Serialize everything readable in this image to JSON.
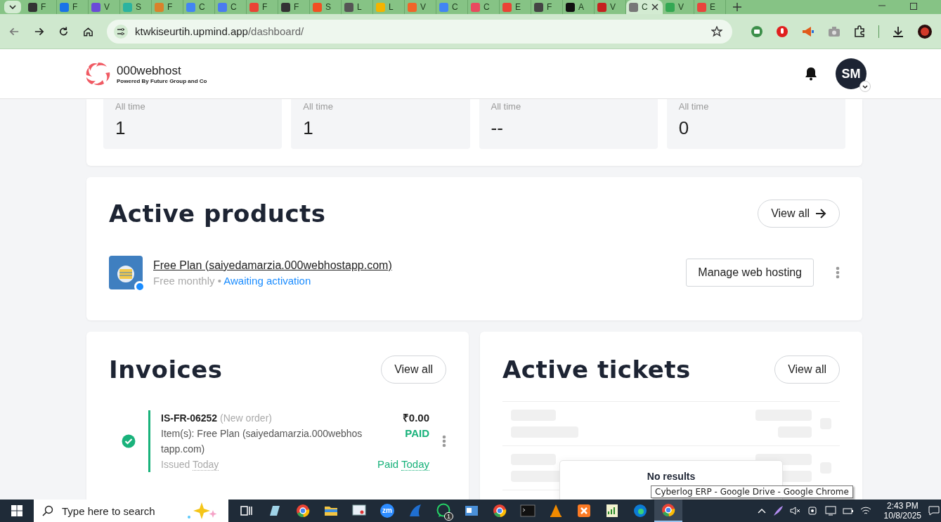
{
  "browser": {
    "tabs": [
      {
        "label": "F",
        "color": "#333333",
        "selected": false
      },
      {
        "label": "F",
        "color": "#1a73e8",
        "selected": false
      },
      {
        "label": "V",
        "color": "#6b4bd8",
        "selected": false
      },
      {
        "label": "S",
        "color": "#2bb3a0",
        "selected": false
      },
      {
        "label": "F",
        "color": "#d9822b",
        "selected": false
      },
      {
        "label": "C",
        "color": "#4285f4",
        "selected": false
      },
      {
        "label": "C",
        "color": "#4a7cf0",
        "selected": false
      },
      {
        "label": "F",
        "color": "#ea4335",
        "selected": false
      },
      {
        "label": "F",
        "color": "#333333",
        "selected": false
      },
      {
        "label": "S",
        "color": "#f25022",
        "selected": false
      },
      {
        "label": "L",
        "color": "#555555",
        "selected": false
      },
      {
        "label": "L",
        "color": "#f4b400",
        "selected": false
      },
      {
        "label": "V",
        "color": "#f06529",
        "selected": false
      },
      {
        "label": "C",
        "color": "#4285f4",
        "selected": false
      },
      {
        "label": "C",
        "color": "#e84a5f",
        "selected": false
      },
      {
        "label": "E",
        "color": "#ea4335",
        "selected": false
      },
      {
        "label": "F",
        "color": "#444444",
        "selected": false
      },
      {
        "label": "A",
        "color": "#111111",
        "selected": false
      },
      {
        "label": "V",
        "color": "#c5221f",
        "selected": false
      },
      {
        "label": "C",
        "color": "#777777",
        "selected": true
      },
      {
        "label": "V",
        "color": "#34a853",
        "selected": false
      },
      {
        "label": "E",
        "color": "#e8453c",
        "selected": false
      }
    ],
    "address": {
      "host": "ktwkiseurtih.upmind.app",
      "path": "/dashboard/"
    }
  },
  "header": {
    "brand": "000webhost",
    "tagline": "Powered By Future Group and Co",
    "avatar": "SM"
  },
  "stats": [
    {
      "label": "All time",
      "value": "1"
    },
    {
      "label": "All time",
      "value": "1"
    },
    {
      "label": "All time",
      "value": "--"
    },
    {
      "label": "All time",
      "value": "0"
    }
  ],
  "products": {
    "title": "Active products",
    "view_all": "View all",
    "items": [
      {
        "name": "Free Plan (saiyedamarzia.000webhostapp.com)",
        "billing": "Free monthly",
        "separator": "•",
        "status": "Awaiting activation",
        "action": "Manage web hosting"
      }
    ]
  },
  "invoices": {
    "title": "Invoices",
    "view_all": "View all",
    "items": [
      {
        "number": "IS-FR-06252",
        "tag": "(New order)",
        "description": "Item(s): Free Plan (saiyedamarzia.000webhostapp.com)",
        "amount": "₹0.00",
        "status": "PAID",
        "issued_label": "Issued",
        "issued": "Today",
        "paid_label": "Paid",
        "paid": "Today"
      }
    ]
  },
  "tickets": {
    "title": "Active tickets",
    "view_all": "View all",
    "empty_text": "No results"
  },
  "tooltip": "Cyberlog ERP - Google Drive - Google Chrome",
  "taskbar": {
    "search_placeholder": "Type here to search",
    "apps": [
      {
        "kind": "taskview",
        "active": false
      },
      {
        "kind": "notes",
        "active": false
      },
      {
        "kind": "chrome",
        "active": false
      },
      {
        "kind": "folder",
        "active": false
      },
      {
        "kind": "monitor",
        "active": false
      },
      {
        "kind": "zoom",
        "label": "zm",
        "active": false
      },
      {
        "kind": "fin",
        "active": false
      },
      {
        "kind": "chat",
        "badge": "1",
        "active": false
      },
      {
        "kind": "card",
        "active": false
      },
      {
        "kind": "chrome",
        "active": false
      },
      {
        "kind": "terminal",
        "active": false
      },
      {
        "kind": "cone",
        "active": false
      },
      {
        "kind": "xampp",
        "active": false
      },
      {
        "kind": "chart",
        "active": false
      },
      {
        "kind": "edge",
        "active": false
      },
      {
        "kind": "chrome",
        "active": true
      }
    ],
    "time": "2:43 PM",
    "date": "10/8/2025"
  }
}
